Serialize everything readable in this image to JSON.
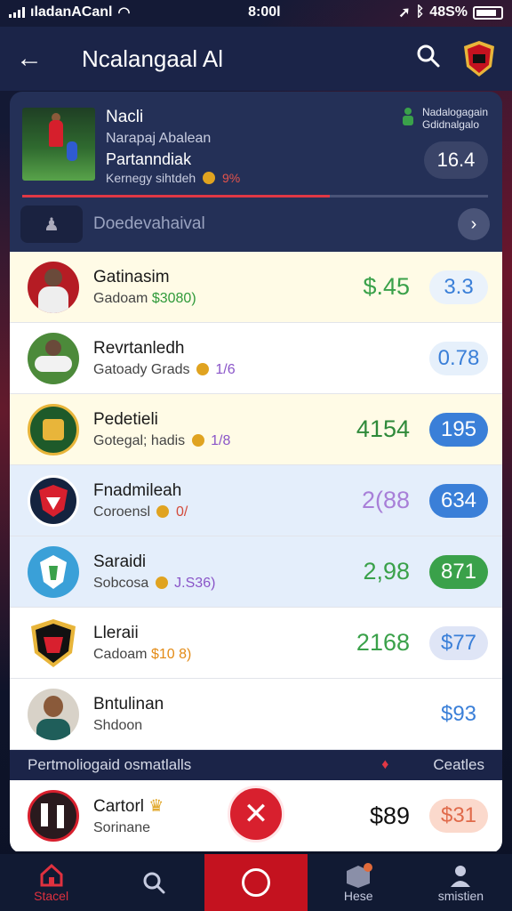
{
  "status_bar": {
    "carrier": "ıladanACanl",
    "time": "8:00l",
    "battery": "48S%"
  },
  "header": {
    "title": "Ncalangaal Al"
  },
  "hero": {
    "name": "Nacli",
    "line1": "Narapaj Abalean",
    "line2": "Partanndiak",
    "line3_text": "Kernegy sihtdeh",
    "line3_pct": "9%",
    "topright_line1": "Nadalogagain",
    "topright_line2": "Gdidnalgalo",
    "score": "16.4",
    "progress": 0.66,
    "filter_label": "Doedevahaival"
  },
  "players": [
    {
      "name": "Gatinasim",
      "sub_prefix": "Gadoam",
      "sub_value": "$3080)",
      "sub_class": "hl-green",
      "has_coin": false,
      "price": "$.45",
      "price_color": "#3aa14a",
      "pill": "3.3",
      "pill_bg": "#eaf2fb",
      "pill_fg": "#3a7fd8",
      "row_bg": "#fffbe6"
    },
    {
      "name": "Revrtanledh",
      "sub_prefix": "Gatoady Grads",
      "sub_value": "1/6",
      "sub_class": "num-purple",
      "has_coin": true,
      "price": "",
      "price_color": "#3aa14a",
      "pill": "0.78",
      "pill_bg": "#e6f0fb",
      "pill_fg": "#3a7fd8",
      "row_bg": "#ffffff"
    },
    {
      "name": "Pedetieli",
      "sub_prefix": "Gotegal; hadis",
      "sub_value": "1/8",
      "sub_class": "num-purple",
      "has_coin": true,
      "price": "4154",
      "price_color": "#2f8a3a",
      "pill": "195",
      "pill_bg": "#3a7fd8",
      "pill_fg": "#ffffff",
      "row_bg": "#fffbe6"
    },
    {
      "name": "Fnadmileah",
      "sub_prefix": "Coroensl",
      "sub_value": "0/",
      "sub_class": "num-red",
      "has_coin": true,
      "price": "2(88",
      "price_color": "#a87fd8",
      "pill": "634",
      "pill_bg": "#3a7fd8",
      "pill_fg": "#ffffff",
      "row_bg": "#e4eefb"
    },
    {
      "name": "Saraidi",
      "sub_prefix": "Sobcosa",
      "sub_value": "J.S36)",
      "sub_class": "num-purple",
      "has_coin": true,
      "price": "2,98",
      "price_color": "#3aa14a",
      "pill": "871",
      "pill_bg": "#3aa14a",
      "pill_fg": "#ffffff",
      "row_bg": "#e4eefb"
    },
    {
      "name": "Lleraii",
      "sub_prefix": "Cadoam",
      "sub_value": "$10 8)",
      "sub_class": "num-orange",
      "has_coin": false,
      "price": "2168",
      "price_color": "#3aa14a",
      "pill": "$77",
      "pill_bg": "#dfe5f6",
      "pill_fg": "#3a7fd8",
      "row_bg": "#ffffff"
    },
    {
      "name": "Bntulinan",
      "sub_prefix": "Shdoon",
      "sub_value": "",
      "sub_class": "",
      "has_coin": false,
      "price": "",
      "price_color": "#3aa14a",
      "pill": "$93",
      "pill_bg": "transparent",
      "pill_fg": "#3a7fd8",
      "row_bg": "#ffffff"
    }
  ],
  "section": {
    "label": "Pertmoliogaid osmatlalls",
    "right": "Ceatles"
  },
  "bottom": {
    "name": "Cartorl",
    "sub": "Sorinane",
    "price": "$89",
    "pill": "$31"
  },
  "tabs": [
    {
      "label": "Stacel",
      "icon": "home-icon"
    },
    {
      "label": "",
      "icon": "search-icon"
    },
    {
      "label": "",
      "icon": "circle-icon"
    },
    {
      "label": "Hese",
      "icon": "box-icon"
    },
    {
      "label": "smistien",
      "icon": "profile-icon"
    }
  ],
  "colors": {
    "accent": "#d8202e",
    "header": "#1b2448",
    "positive": "#3aa14a",
    "info": "#3a7fd8"
  }
}
